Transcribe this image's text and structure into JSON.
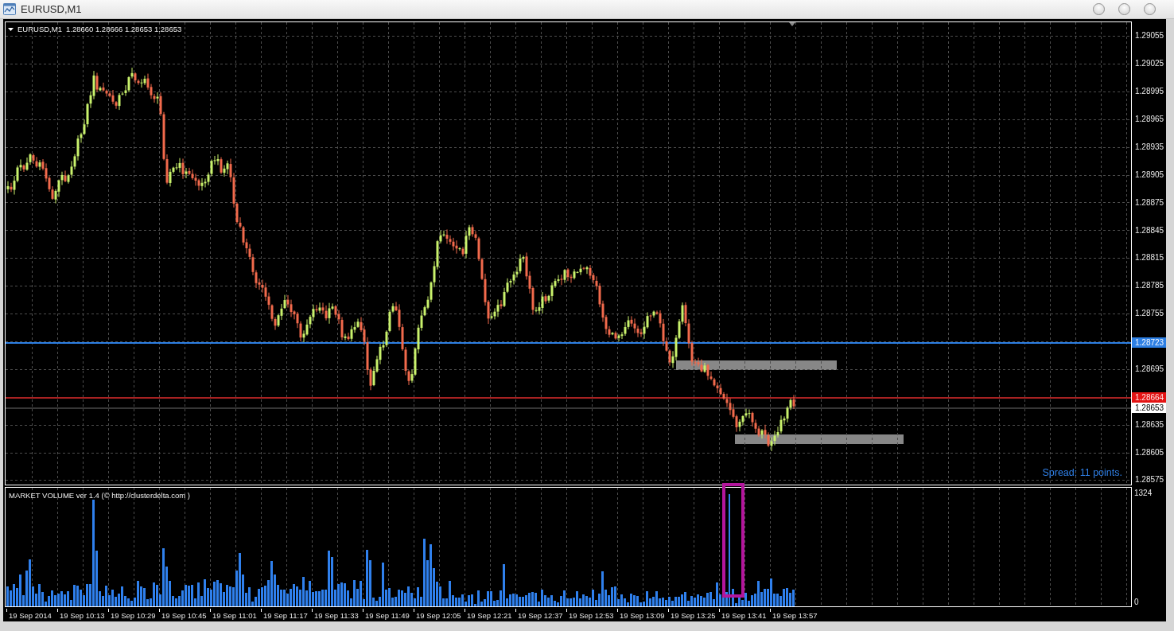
{
  "window": {
    "title": "EURUSD,M1"
  },
  "chart": {
    "symbol": "EURUSD,M1",
    "ohlc": [
      "1.28660",
      "1.28666",
      "1.28653",
      "1.28653"
    ],
    "spread": "Spread: 11 points.",
    "price_axis": [
      {
        "text": "1.29055",
        "kind": "tick"
      },
      {
        "text": "1.29025",
        "kind": "tick"
      },
      {
        "text": "1.28995",
        "kind": "tick"
      },
      {
        "text": "1.28965",
        "kind": "tick"
      },
      {
        "text": "1.28935",
        "kind": "tick"
      },
      {
        "text": "1.28905",
        "kind": "tick"
      },
      {
        "text": "1.28875",
        "kind": "tick"
      },
      {
        "text": "1.28845",
        "kind": "tick"
      },
      {
        "text": "1.28815",
        "kind": "tick"
      },
      {
        "text": "1.28785",
        "kind": "tick"
      },
      {
        "text": "1.28755",
        "kind": "tick"
      },
      {
        "text": "1.28723",
        "kind": "level"
      },
      {
        "text": "1.28695",
        "kind": "tick"
      },
      {
        "text": "1.28664",
        "kind": "ask"
      },
      {
        "text": "1.28653",
        "kind": "bid"
      },
      {
        "text": "1.28635",
        "kind": "tick"
      },
      {
        "text": "1.28605",
        "kind": "tick"
      },
      {
        "text": "1.28575",
        "kind": "tick"
      }
    ]
  },
  "volume_indicator": {
    "title": "MARKET VOLUME ver 1.4 (© http://clusterdelta.com )",
    "axis": [
      "1324",
      "0"
    ]
  },
  "time_axis": [
    "19 Sep 2014",
    "19 Sep 10:13",
    "19 Sep 10:29",
    "19 Sep 10:45",
    "19 Sep 11:01",
    "19 Sep 11:17",
    "19 Sep 11:33",
    "19 Sep 11:49",
    "19 Sep 12:05",
    "19 Sep 12:21",
    "19 Sep 12:37",
    "19 Sep 12:53",
    "19 Sep 13:09",
    "19 Sep 13:25",
    "19 Sep 13:41",
    "19 Sep 13:57"
  ]
}
